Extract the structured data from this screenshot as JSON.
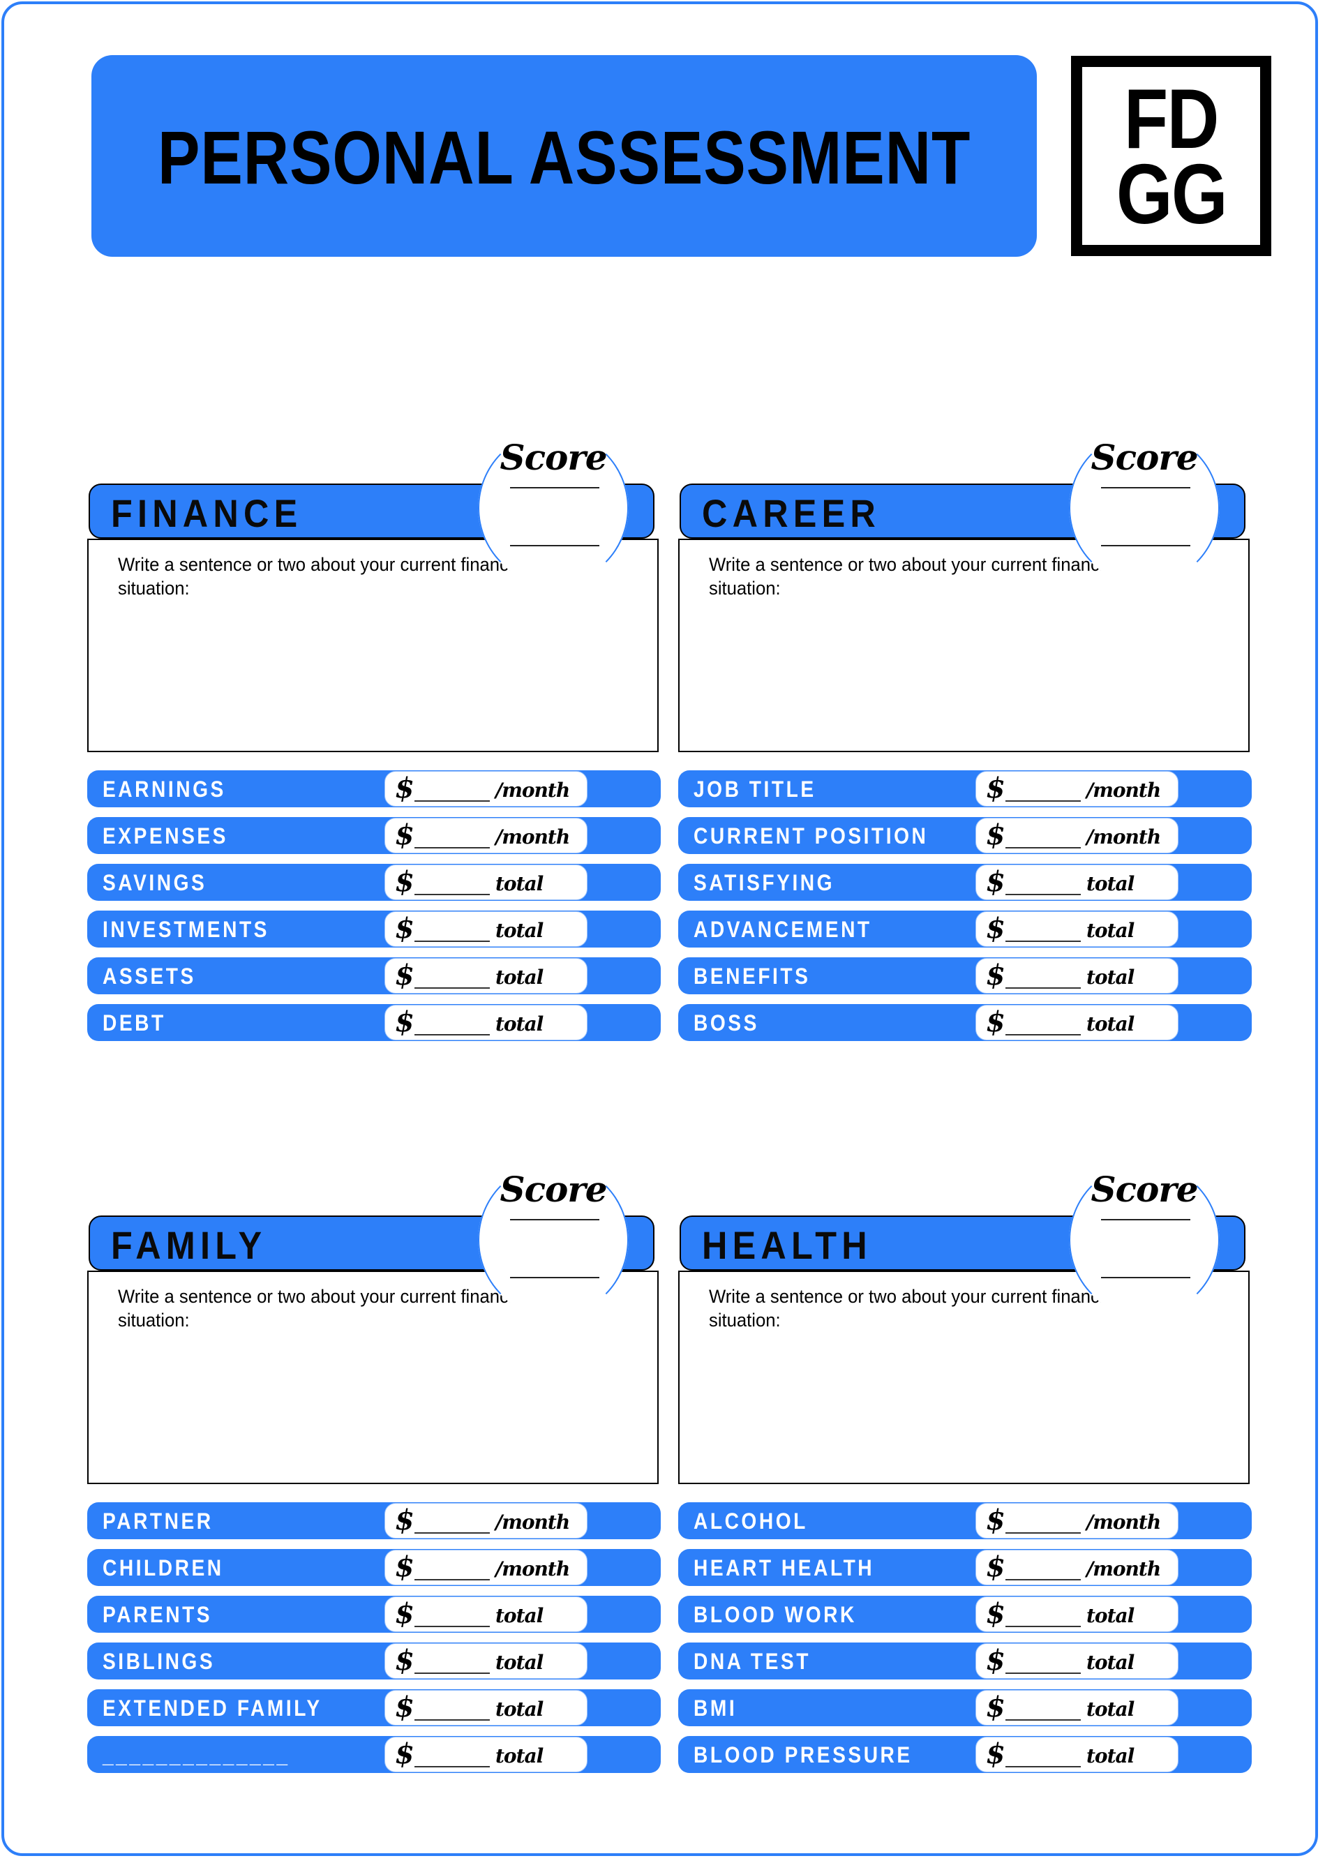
{
  "header": {
    "title": "PERSONAL ASSESSMENT",
    "logo_line1": "FD",
    "logo_line2": "GG"
  },
  "colors": {
    "accent": "#2d7ff9",
    "text": "#000000",
    "row_text": "#ffffff"
  },
  "score_label": "Score",
  "currency_symbol": "$",
  "sections": [
    {
      "title": "FINANCE",
      "prompt": "Write a sentence or two about your current financial situation:",
      "rows": [
        {
          "label": "EARNINGS",
          "unit": "/month"
        },
        {
          "label": "EXPENSES",
          "unit": "/month"
        },
        {
          "label": "SAVINGS",
          "unit": "total"
        },
        {
          "label": "INVESTMENTS",
          "unit": "total"
        },
        {
          "label": "ASSETS",
          "unit": "total"
        },
        {
          "label": "DEBT",
          "unit": "total"
        }
      ]
    },
    {
      "title": "CAREER",
      "prompt": "Write a sentence or two about your current financial situation:",
      "rows": [
        {
          "label": "JOB TITLE",
          "unit": "/month"
        },
        {
          "label": "CURRENT POSITION",
          "unit": "/month"
        },
        {
          "label": "SATISFYING",
          "unit": "total"
        },
        {
          "label": "ADVANCEMENT",
          "unit": "total"
        },
        {
          "label": "BENEFITS",
          "unit": "total"
        },
        {
          "label": "BOSS",
          "unit": "total"
        }
      ]
    },
    {
      "title": "FAMILY",
      "prompt": "Write a sentence or two about your current financial situation:",
      "rows": [
        {
          "label": "PARTNER",
          "unit": "/month"
        },
        {
          "label": "CHILDREN",
          "unit": "/month"
        },
        {
          "label": "PARENTS",
          "unit": "total"
        },
        {
          "label": "SIBLINGS",
          "unit": "total"
        },
        {
          "label": "EXTENDED FAMILY",
          "unit": "total"
        },
        {
          "label": "______________",
          "unit": "total"
        }
      ]
    },
    {
      "title": "HEALTH",
      "prompt": "Write a sentence or two about your current financial situation:",
      "rows": [
        {
          "label": "ALCOHOL",
          "unit": "/month"
        },
        {
          "label": "HEART HEALTH",
          "unit": "/month"
        },
        {
          "label": "BLOOD WORK",
          "unit": "total"
        },
        {
          "label": "DNA TEST",
          "unit": "total"
        },
        {
          "label": "BMI",
          "unit": "total"
        },
        {
          "label": "BLOOD PRESSURE",
          "unit": "total"
        }
      ]
    }
  ]
}
